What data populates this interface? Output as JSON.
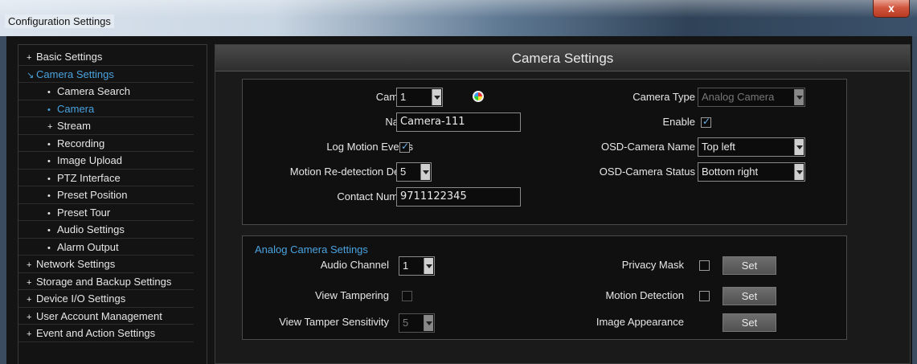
{
  "window": {
    "title": "Configuration Settings",
    "close_label": "x"
  },
  "sidebar": {
    "items": [
      {
        "label": "Basic Settings",
        "bullet": "+",
        "level": "top",
        "active": false
      },
      {
        "label": "Camera Settings",
        "bullet": "↘",
        "level": "top",
        "active": true
      },
      {
        "label": "Camera Search",
        "bullet": "•",
        "level": "sub",
        "active": false
      },
      {
        "label": "Camera",
        "bullet": "•",
        "level": "sub",
        "active": true
      },
      {
        "label": "Stream",
        "bullet": "+",
        "level": "sub",
        "active": false
      },
      {
        "label": "Recording",
        "bullet": "•",
        "level": "sub",
        "active": false
      },
      {
        "label": "Image Upload",
        "bullet": "•",
        "level": "sub",
        "active": false
      },
      {
        "label": "PTZ Interface",
        "bullet": "•",
        "level": "sub",
        "active": false
      },
      {
        "label": "Preset Position",
        "bullet": "•",
        "level": "sub",
        "active": false
      },
      {
        "label": "Preset Tour",
        "bullet": "•",
        "level": "sub",
        "active": false
      },
      {
        "label": "Audio Settings",
        "bullet": "•",
        "level": "sub",
        "active": false
      },
      {
        "label": "Alarm Output",
        "bullet": "•",
        "level": "sub",
        "active": false
      },
      {
        "label": "Network Settings",
        "bullet": "+",
        "level": "top",
        "active": false
      },
      {
        "label": "Storage and Backup Settings",
        "bullet": "+",
        "level": "top",
        "active": false
      },
      {
        "label": "Device I/O Settings",
        "bullet": "+",
        "level": "top",
        "active": false
      },
      {
        "label": "User Account Management",
        "bullet": "+",
        "level": "top",
        "active": false
      },
      {
        "label": "Event and Action Settings",
        "bullet": "+",
        "level": "top",
        "active": false
      }
    ]
  },
  "main": {
    "header": "Camera Settings",
    "camera": {
      "camera_label": "Camera",
      "camera_value": "1",
      "name_label": "Name",
      "name_value": "Camera-111",
      "log_motion_label": "Log Motion Events",
      "log_motion_checked": true,
      "motion_delay_label": "Motion Re-detection Delay",
      "motion_delay_value": "5",
      "contact_label": "Contact Number",
      "contact_value": "9711122345",
      "camera_type_label": "Camera Type",
      "camera_type_value": "Analog Camera",
      "enable_label": "Enable",
      "enable_checked": true,
      "osd_name_label": "OSD-Camera Name",
      "osd_name_value": "Top left",
      "osd_status_label": "OSD-Camera Status",
      "osd_status_value": "Bottom right"
    },
    "analog": {
      "title": "Analog Camera Settings",
      "audio_channel_label": "Audio Channel",
      "audio_channel_value": "1",
      "view_tampering_label": "View Tampering",
      "view_tampering_checked": false,
      "tamper_sensitivity_label": "View Tamper Sensitivity",
      "tamper_sensitivity_value": "5",
      "privacy_mask_label": "Privacy Mask",
      "privacy_mask_checked": false,
      "motion_detection_label": "Motion Detection",
      "motion_detection_checked": false,
      "image_appearance_label": "Image Appearance",
      "set_label": "Set"
    }
  }
}
